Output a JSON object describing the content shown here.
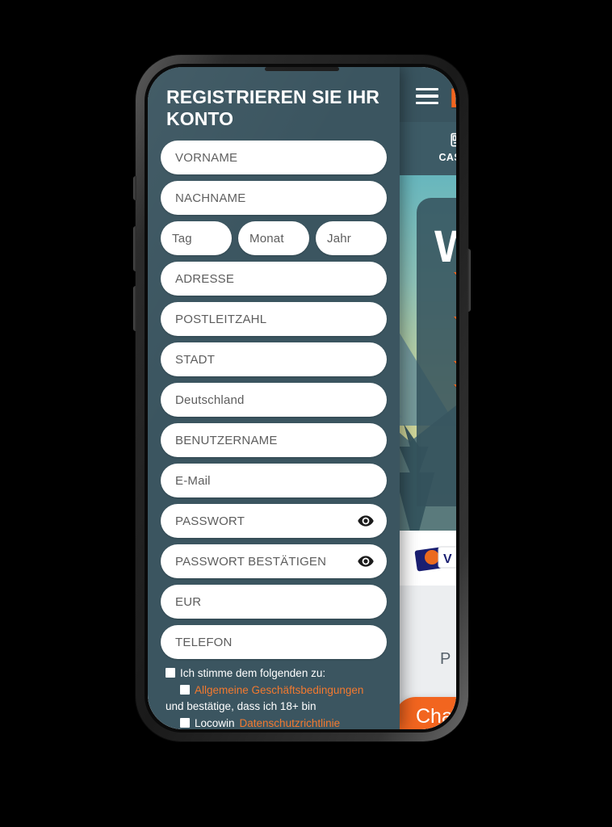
{
  "device": {
    "type": "smartphone"
  },
  "background_page": {
    "brand_logo": "L",
    "menu_icon": "hamburger-menu-icon",
    "nav": [
      {
        "icon": "slot-machine-icon",
        "label": "CASINO"
      }
    ],
    "hero": {
      "headline_fragment": "W",
      "chevron_count": 4
    },
    "payments_label": "P",
    "chat_button": "Chat"
  },
  "register_modal": {
    "title": "REGISTRIEREN SIE IHR KONTO",
    "fields": [
      {
        "name": "first-name",
        "placeholder": "VORNAME",
        "value": ""
      },
      {
        "name": "last-name",
        "placeholder": "NACHNAME",
        "value": ""
      },
      {
        "name": "birth-day",
        "placeholder": "Tag",
        "value": ""
      },
      {
        "name": "birth-month",
        "placeholder": "Monat",
        "value": ""
      },
      {
        "name": "birth-year",
        "placeholder": "Jahr",
        "value": ""
      },
      {
        "name": "address",
        "placeholder": "ADRESSE",
        "value": ""
      },
      {
        "name": "postal-code",
        "placeholder": "POSTLEITZAHL",
        "value": ""
      },
      {
        "name": "city",
        "placeholder": "STADT",
        "value": ""
      },
      {
        "name": "country",
        "placeholder": "Deutschland",
        "value": "Deutschland"
      },
      {
        "name": "username",
        "placeholder": "BENUTZERNAME",
        "value": ""
      },
      {
        "name": "email",
        "placeholder": "E-Mail",
        "value": ""
      },
      {
        "name": "password",
        "placeholder": "PASSWORT",
        "value": ""
      },
      {
        "name": "password-confirm",
        "placeholder": "PASSWORT BESTÄTIGEN",
        "value": ""
      },
      {
        "name": "currency",
        "placeholder": "EUR",
        "value": "EUR"
      },
      {
        "name": "phone",
        "placeholder": "TELEFON",
        "value": ""
      }
    ],
    "terms": {
      "line1": "Ich stimme dem folgenden zu:",
      "line2_link": "Allgemeine Geschäftsbedingungen",
      "line3": "und bestätige, dass ich 18+ bin",
      "line4_prefix": "Locowin",
      "line4_link": "Datenschutzrichtlinie"
    }
  },
  "colors": {
    "modal_bg": "#3b5560",
    "topbar_bg": "#39545f",
    "accent_orange": "#f2651f",
    "link_orange": "#f2792f",
    "field_bg": "#ffffff",
    "placeholder_text": "#5d5d5d"
  }
}
